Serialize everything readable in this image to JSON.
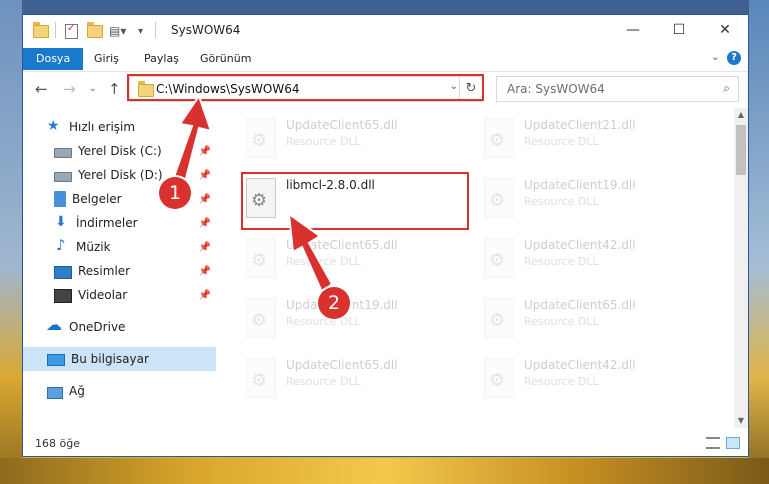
{
  "window": {
    "title": "SysWOW64",
    "minimize_glyph": "—",
    "maximize_glyph": "☐",
    "close_glyph": "✕"
  },
  "ribbon": {
    "tabs": [
      "Dosya",
      "Giriş",
      "Paylaş",
      "Görünüm"
    ],
    "help_glyph": "?"
  },
  "nav": {
    "address": "C:\\Windows\\SysWOW64",
    "search_placeholder": "Ara: SysWOW64"
  },
  "sidebar": {
    "items": [
      {
        "label": "Hızlı erişim",
        "icon": "star-icon",
        "pinned": false
      },
      {
        "label": "Yerel Disk (C:)",
        "icon": "drive-icon",
        "pinned": true
      },
      {
        "label": "Yerel Disk (D:)",
        "icon": "drive-icon",
        "pinned": true
      },
      {
        "label": "Belgeler",
        "icon": "documents-icon",
        "pinned": true
      },
      {
        "label": "İndirmeler",
        "icon": "downloads-icon",
        "pinned": true
      },
      {
        "label": "Müzik",
        "icon": "music-icon",
        "pinned": true
      },
      {
        "label": "Resimler",
        "icon": "pictures-icon",
        "pinned": true
      },
      {
        "label": "Videolar",
        "icon": "videos-icon",
        "pinned": true
      },
      {
        "label": "OneDrive",
        "icon": "onedrive-icon",
        "pinned": false
      },
      {
        "label": "Bu bilgisayar",
        "icon": "computer-icon",
        "pinned": false,
        "selected": true
      },
      {
        "label": "Ağ",
        "icon": "network-icon",
        "pinned": false
      }
    ]
  },
  "files": [
    {
      "name": "UpdateClient65.dll",
      "type": "Resource DLL",
      "faded": true
    },
    {
      "name": "UpdateClient21.dll",
      "type": "Resource DLL",
      "faded": true
    },
    {
      "name": "libmcl-2.8.0.dll",
      "type": "",
      "faded": false,
      "highlighted": true
    },
    {
      "name": "UpdateClient19.dll",
      "type": "Resource DLL",
      "faded": true
    },
    {
      "name": "UpdateClient65.dll",
      "type": "Resource DLL",
      "faded": true
    },
    {
      "name": "UpdateClient42.dll",
      "type": "Resource DLL",
      "faded": true
    },
    {
      "name": "UpdateClient19.dll",
      "type": "Resource DLL",
      "faded": true
    },
    {
      "name": "UpdateClient65.dll",
      "type": "Resource DLL",
      "faded": true
    },
    {
      "name": "UpdateClient65.dll",
      "type": "Resource DLL",
      "faded": true
    },
    {
      "name": "UpdateClient42.dll",
      "type": "Resource DLL",
      "faded": true
    }
  ],
  "status": {
    "item_count": "168 öğe"
  },
  "annotations": {
    "step1": "1",
    "step2": "2",
    "color": "#d9322e"
  }
}
